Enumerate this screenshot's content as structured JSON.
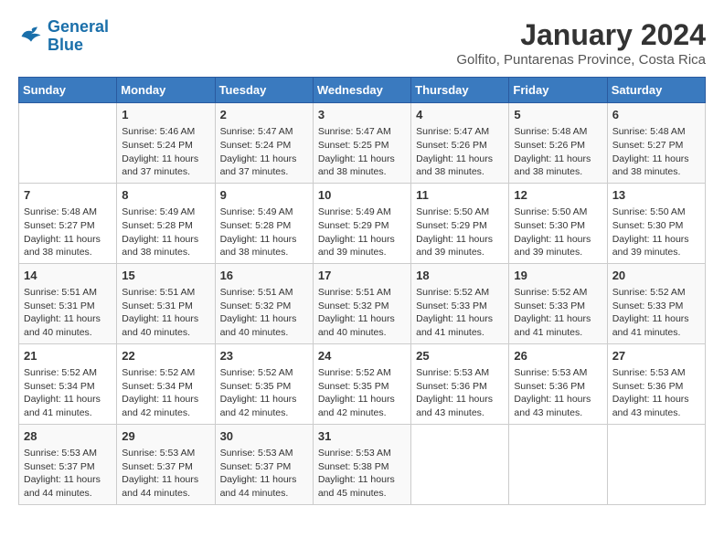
{
  "header": {
    "logo_line1": "General",
    "logo_line2": "Blue",
    "main_title": "January 2024",
    "subtitle": "Golfito, Puntarenas Province, Costa Rica"
  },
  "calendar": {
    "days_of_week": [
      "Sunday",
      "Monday",
      "Tuesday",
      "Wednesday",
      "Thursday",
      "Friday",
      "Saturday"
    ],
    "weeks": [
      [
        {
          "day": "",
          "info": ""
        },
        {
          "day": "1",
          "info": "Sunrise: 5:46 AM\nSunset: 5:24 PM\nDaylight: 11 hours\nand 37 minutes."
        },
        {
          "day": "2",
          "info": "Sunrise: 5:47 AM\nSunset: 5:24 PM\nDaylight: 11 hours\nand 37 minutes."
        },
        {
          "day": "3",
          "info": "Sunrise: 5:47 AM\nSunset: 5:25 PM\nDaylight: 11 hours\nand 38 minutes."
        },
        {
          "day": "4",
          "info": "Sunrise: 5:47 AM\nSunset: 5:26 PM\nDaylight: 11 hours\nand 38 minutes."
        },
        {
          "day": "5",
          "info": "Sunrise: 5:48 AM\nSunset: 5:26 PM\nDaylight: 11 hours\nand 38 minutes."
        },
        {
          "day": "6",
          "info": "Sunrise: 5:48 AM\nSunset: 5:27 PM\nDaylight: 11 hours\nand 38 minutes."
        }
      ],
      [
        {
          "day": "7",
          "info": "Sunrise: 5:48 AM\nSunset: 5:27 PM\nDaylight: 11 hours\nand 38 minutes."
        },
        {
          "day": "8",
          "info": "Sunrise: 5:49 AM\nSunset: 5:28 PM\nDaylight: 11 hours\nand 38 minutes."
        },
        {
          "day": "9",
          "info": "Sunrise: 5:49 AM\nSunset: 5:28 PM\nDaylight: 11 hours\nand 38 minutes."
        },
        {
          "day": "10",
          "info": "Sunrise: 5:49 AM\nSunset: 5:29 PM\nDaylight: 11 hours\nand 39 minutes."
        },
        {
          "day": "11",
          "info": "Sunrise: 5:50 AM\nSunset: 5:29 PM\nDaylight: 11 hours\nand 39 minutes."
        },
        {
          "day": "12",
          "info": "Sunrise: 5:50 AM\nSunset: 5:30 PM\nDaylight: 11 hours\nand 39 minutes."
        },
        {
          "day": "13",
          "info": "Sunrise: 5:50 AM\nSunset: 5:30 PM\nDaylight: 11 hours\nand 39 minutes."
        }
      ],
      [
        {
          "day": "14",
          "info": "Sunrise: 5:51 AM\nSunset: 5:31 PM\nDaylight: 11 hours\nand 40 minutes."
        },
        {
          "day": "15",
          "info": "Sunrise: 5:51 AM\nSunset: 5:31 PM\nDaylight: 11 hours\nand 40 minutes."
        },
        {
          "day": "16",
          "info": "Sunrise: 5:51 AM\nSunset: 5:32 PM\nDaylight: 11 hours\nand 40 minutes."
        },
        {
          "day": "17",
          "info": "Sunrise: 5:51 AM\nSunset: 5:32 PM\nDaylight: 11 hours\nand 40 minutes."
        },
        {
          "day": "18",
          "info": "Sunrise: 5:52 AM\nSunset: 5:33 PM\nDaylight: 11 hours\nand 41 minutes."
        },
        {
          "day": "19",
          "info": "Sunrise: 5:52 AM\nSunset: 5:33 PM\nDaylight: 11 hours\nand 41 minutes."
        },
        {
          "day": "20",
          "info": "Sunrise: 5:52 AM\nSunset: 5:33 PM\nDaylight: 11 hours\nand 41 minutes."
        }
      ],
      [
        {
          "day": "21",
          "info": "Sunrise: 5:52 AM\nSunset: 5:34 PM\nDaylight: 11 hours\nand 41 minutes."
        },
        {
          "day": "22",
          "info": "Sunrise: 5:52 AM\nSunset: 5:34 PM\nDaylight: 11 hours\nand 42 minutes."
        },
        {
          "day": "23",
          "info": "Sunrise: 5:52 AM\nSunset: 5:35 PM\nDaylight: 11 hours\nand 42 minutes."
        },
        {
          "day": "24",
          "info": "Sunrise: 5:52 AM\nSunset: 5:35 PM\nDaylight: 11 hours\nand 42 minutes."
        },
        {
          "day": "25",
          "info": "Sunrise: 5:53 AM\nSunset: 5:36 PM\nDaylight: 11 hours\nand 43 minutes."
        },
        {
          "day": "26",
          "info": "Sunrise: 5:53 AM\nSunset: 5:36 PM\nDaylight: 11 hours\nand 43 minutes."
        },
        {
          "day": "27",
          "info": "Sunrise: 5:53 AM\nSunset: 5:36 PM\nDaylight: 11 hours\nand 43 minutes."
        }
      ],
      [
        {
          "day": "28",
          "info": "Sunrise: 5:53 AM\nSunset: 5:37 PM\nDaylight: 11 hours\nand 44 minutes."
        },
        {
          "day": "29",
          "info": "Sunrise: 5:53 AM\nSunset: 5:37 PM\nDaylight: 11 hours\nand 44 minutes."
        },
        {
          "day": "30",
          "info": "Sunrise: 5:53 AM\nSunset: 5:37 PM\nDaylight: 11 hours\nand 44 minutes."
        },
        {
          "day": "31",
          "info": "Sunrise: 5:53 AM\nSunset: 5:38 PM\nDaylight: 11 hours\nand 45 minutes."
        },
        {
          "day": "",
          "info": ""
        },
        {
          "day": "",
          "info": ""
        },
        {
          "day": "",
          "info": ""
        }
      ]
    ]
  }
}
